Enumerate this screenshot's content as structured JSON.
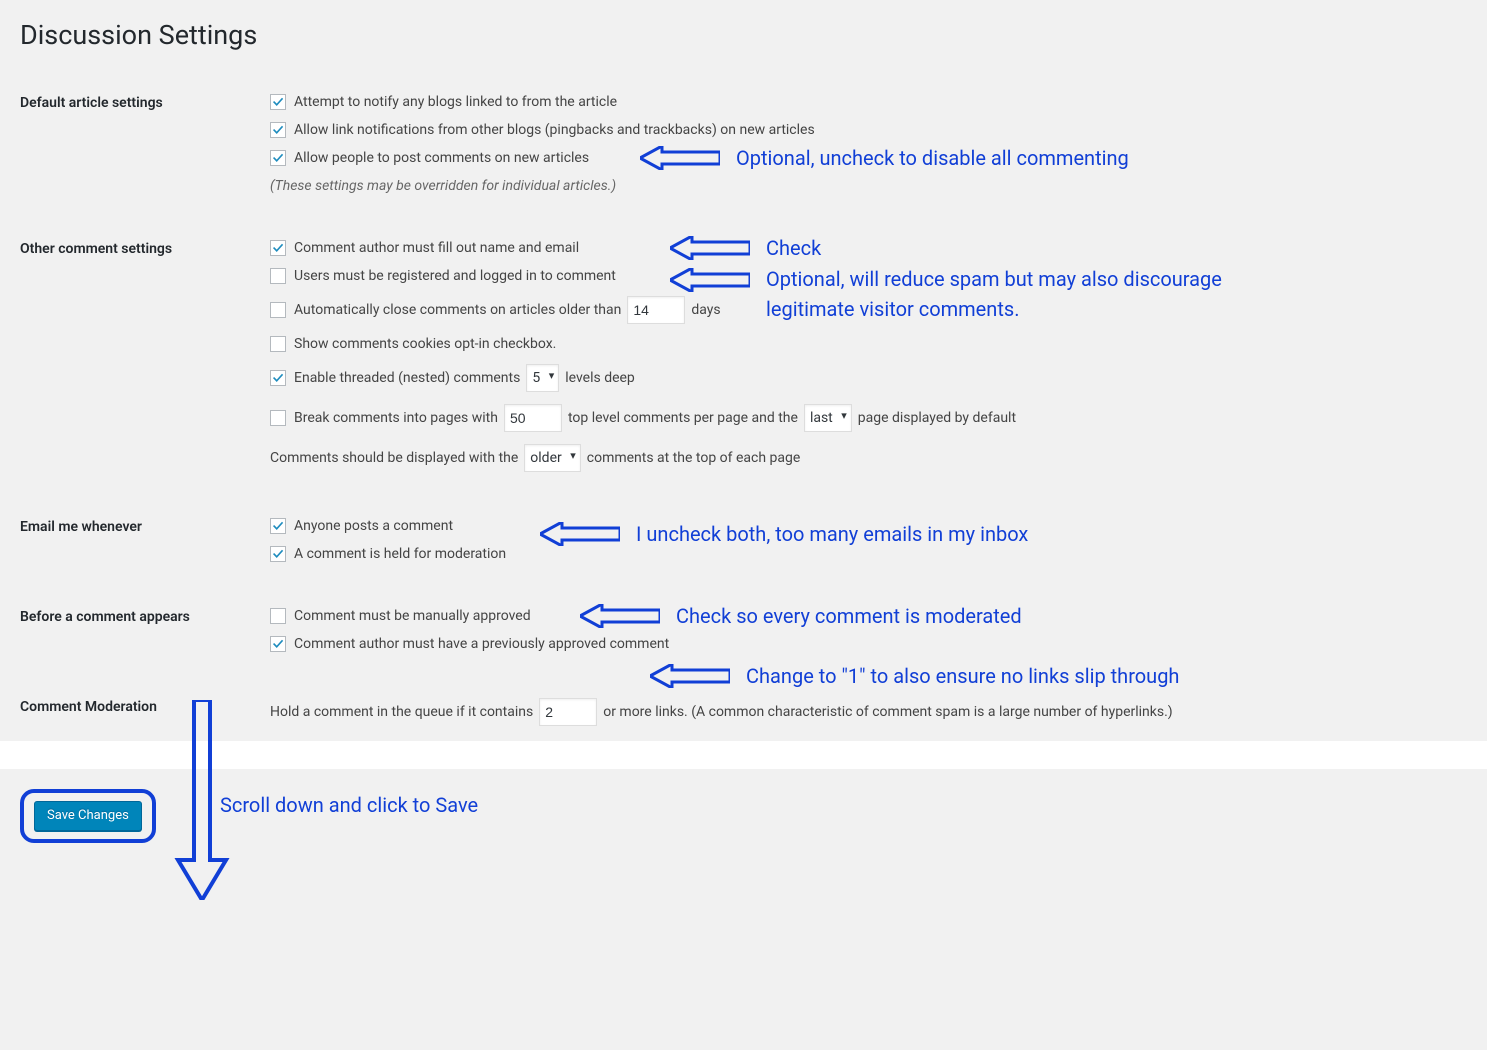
{
  "page_title": "Discussion Settings",
  "sections": {
    "default_article": {
      "heading": "Default article settings",
      "notify_blogs": "Attempt to notify any blogs linked to from the article",
      "allow_pingbacks": "Allow link notifications from other blogs (pingbacks and trackbacks) on new articles",
      "allow_comments": "Allow people to post comments on new articles",
      "note": "(These settings may be overridden for individual articles.)"
    },
    "other_comment": {
      "heading": "Other comment settings",
      "require_name_email": "Comment author must fill out name and email",
      "require_registration": "Users must be registered and logged in to comment",
      "close_old_prefix": "Automatically close comments on articles older than",
      "close_old_value": "14",
      "close_old_suffix": "days",
      "show_cookies": "Show comments cookies opt-in checkbox.",
      "threaded_prefix": "Enable threaded (nested) comments",
      "threaded_value": "5",
      "threaded_suffix": "levels deep",
      "paginate_prefix": "Break comments into pages with",
      "paginate_value": "50",
      "paginate_mid": "top level comments per page and the",
      "paginate_sel": "last",
      "paginate_suffix": "page displayed by default",
      "order_prefix": "Comments should be displayed with the",
      "order_sel": "older",
      "order_suffix": "comments at the top of each page"
    },
    "email_me": {
      "heading": "Email me whenever",
      "anyone_posts": "Anyone posts a comment",
      "held_moderation": "A comment is held for moderation"
    },
    "before_appears": {
      "heading": "Before a comment appears",
      "manual_approve": "Comment must be manually approved",
      "prev_approved": "Comment author must have a previously approved comment"
    },
    "moderation": {
      "heading": "Comment Moderation",
      "hold_prefix": "Hold a comment in the queue if it contains",
      "hold_value": "2",
      "hold_suffix": "or more links. (A common characteristic of comment spam is a large number of hyperlinks.)"
    }
  },
  "save_button": "Save Changes",
  "annotations": {
    "allow_comments": "Optional, uncheck to disable all commenting",
    "require_name": "Check",
    "require_reg": "Optional, will reduce spam but may also discourage legitimate visitor comments.",
    "email_both": "I uncheck both, too many emails in my inbox",
    "manual_approve": "Check so every comment is moderated",
    "links": "Change to \"1\" to also ensure no links slip through",
    "save": "Scroll down and click to Save"
  }
}
